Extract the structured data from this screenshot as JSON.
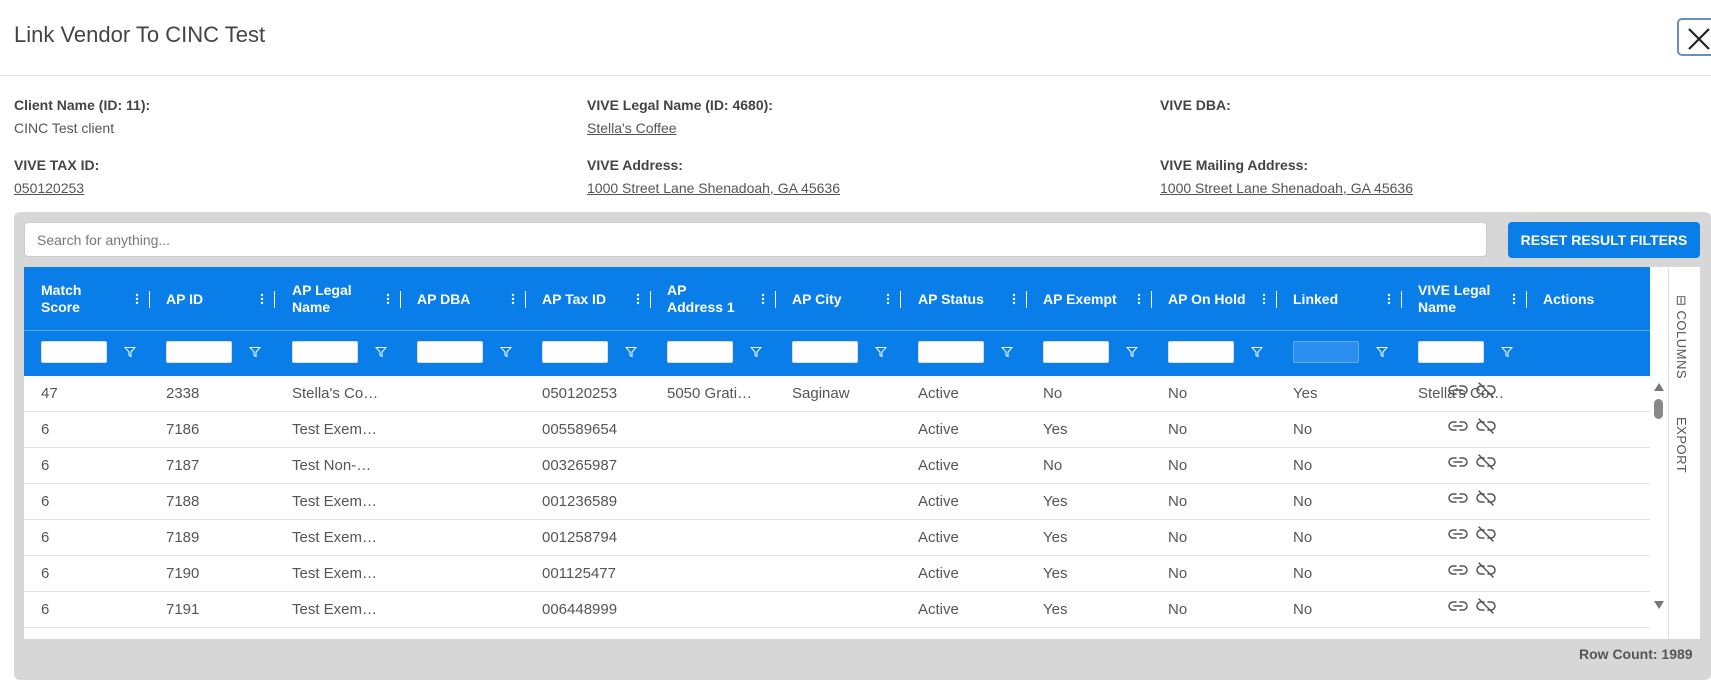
{
  "dialog": {
    "title": "Link Vendor To CINC Test"
  },
  "info": {
    "client_name_label": "Client Name (ID: 11):",
    "client_name_value": "CINC Test client",
    "legal_name_label": "VIVE Legal Name (ID: 4680):",
    "legal_name_value": "Stella's Coffee",
    "dba_label": "VIVE DBA:",
    "dba_value": "",
    "tax_id_label": "VIVE TAX ID:",
    "tax_id_value": "050120253",
    "address_label": "VIVE Address:",
    "address_value": "1000 Street Lane Shenadoah, GA 45636",
    "mailing_label": "VIVE Mailing Address:",
    "mailing_value": "1000 Street Lane Shenadoah, GA 45636"
  },
  "toolbar": {
    "search_placeholder": "Search for anything...",
    "reset_label": "RESET RESULT FILTERS"
  },
  "grid": {
    "columns": [
      "Match Score",
      "AP ID",
      "AP Legal Name",
      "AP DBA",
      "AP Tax ID",
      "AP Address 1",
      "AP City",
      "AP Status",
      "AP Exempt",
      "AP On Hold",
      "Linked",
      "VIVE Legal Name",
      "Actions"
    ],
    "rows": [
      [
        "47",
        "2338",
        "Stella's Co…",
        "",
        "050120253",
        "5050 Grati…",
        "Saginaw",
        "Active",
        "No",
        "No",
        "Yes",
        "Stella's Co…"
      ],
      [
        "6",
        "7186",
        "Test Exem…",
        "",
        "005589654",
        "",
        "",
        "Active",
        "Yes",
        "No",
        "No",
        ""
      ],
      [
        "6",
        "7187",
        "Test Non-…",
        "",
        "003265987",
        "",
        "",
        "Active",
        "No",
        "No",
        "No",
        ""
      ],
      [
        "6",
        "7188",
        "Test Exem…",
        "",
        "001236589",
        "",
        "",
        "Active",
        "Yes",
        "No",
        "No",
        ""
      ],
      [
        "6",
        "7189",
        "Test Exem…",
        "",
        "001258794",
        "",
        "",
        "Active",
        "Yes",
        "No",
        "No",
        ""
      ],
      [
        "6",
        "7190",
        "Test Exem…",
        "",
        "001125477",
        "",
        "",
        "Active",
        "Yes",
        "No",
        "No",
        ""
      ],
      [
        "6",
        "7191",
        "Test Exem…",
        "",
        "006448999",
        "",
        "",
        "Active",
        "Yes",
        "No",
        "No",
        ""
      ]
    ],
    "side_tabs": [
      "COLUMNS",
      "EXPORT"
    ],
    "row_count": "Row Count: 1989"
  },
  "colors": {
    "accent": "#0a7ee8",
    "panel": "#d7d7d7"
  },
  "icons": [
    "close-icon",
    "column-menu-icon",
    "filter-icon",
    "link-icon",
    "unlink-icon",
    "columns-icon"
  ]
}
